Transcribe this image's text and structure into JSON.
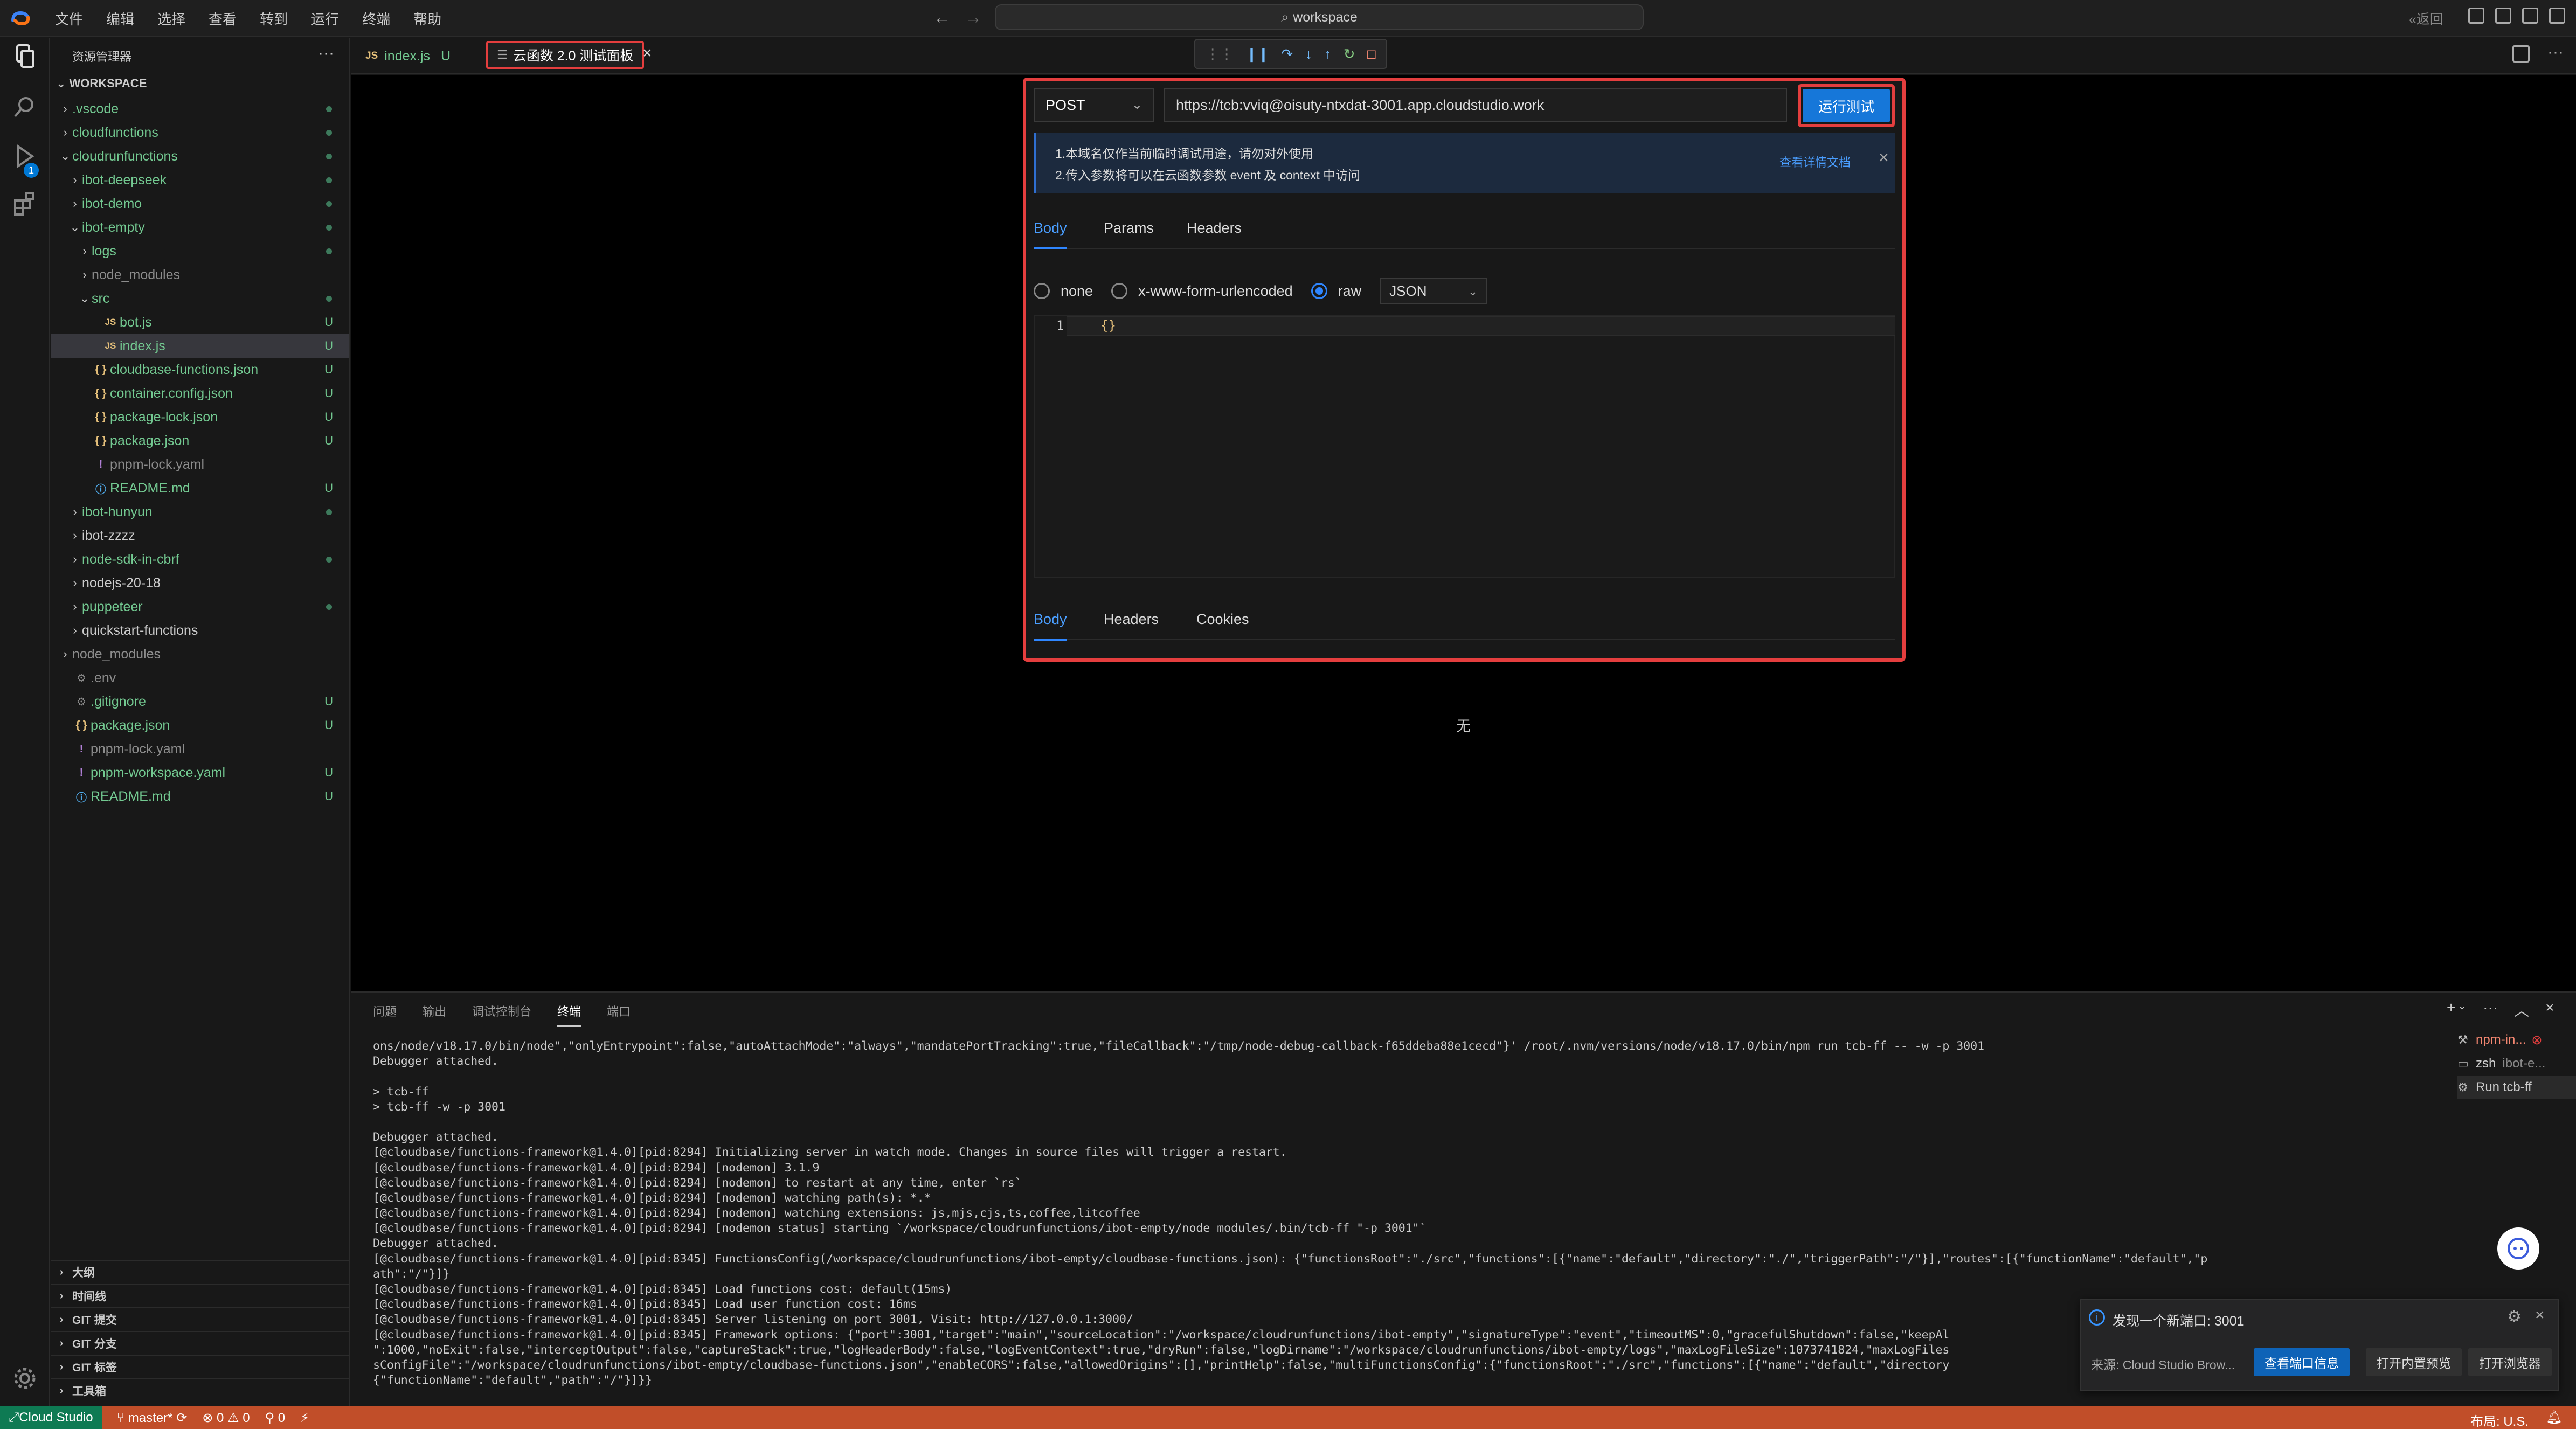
{
  "menus": [
    "文件",
    "编辑",
    "选择",
    "查看",
    "转到",
    "运行",
    "终端",
    "帮助"
  ],
  "command_center": "workspace",
  "return_label": "返回",
  "activity": [
    "files-icon",
    "search-icon",
    "run-debug-icon",
    "extensions-icon",
    "settings-gear-icon"
  ],
  "activity_badge": "1",
  "sidebar": {
    "title": "资源管理器",
    "workspace": "WORKSPACE",
    "items": [
      {
        "label": ".vscode",
        "indent": 1,
        "kind": "folder",
        "open": false,
        "color": "green",
        "status": "dot"
      },
      {
        "label": "cloudfunctions",
        "indent": 1,
        "kind": "folder",
        "open": false,
        "color": "green",
        "status": "dot"
      },
      {
        "label": "cloudrunfunctions",
        "indent": 1,
        "kind": "folder",
        "open": true,
        "color": "green",
        "status": "dot"
      },
      {
        "label": "ibot-deepseek",
        "indent": 2,
        "kind": "folder",
        "open": false,
        "color": "green",
        "status": "dot"
      },
      {
        "label": "ibot-demo",
        "indent": 2,
        "kind": "folder",
        "open": false,
        "color": "green",
        "status": "dot"
      },
      {
        "label": "ibot-empty",
        "indent": 2,
        "kind": "folder",
        "open": true,
        "color": "green",
        "status": "dot"
      },
      {
        "label": "logs",
        "indent": 3,
        "kind": "folder",
        "open": false,
        "color": "green",
        "status": "dot"
      },
      {
        "label": "node_modules",
        "indent": 3,
        "kind": "folder",
        "open": false,
        "color": "gray",
        "status": ""
      },
      {
        "label": "src",
        "indent": 3,
        "kind": "folder",
        "open": true,
        "color": "green",
        "status": "dot"
      },
      {
        "label": "bot.js",
        "indent": 4,
        "kind": "js",
        "color": "green",
        "status": "U"
      },
      {
        "label": "index.js",
        "indent": 4,
        "kind": "js",
        "color": "green",
        "status": "U",
        "selected": true
      },
      {
        "label": "cloudbase-functions.json",
        "indent": 3,
        "kind": "json",
        "color": "green",
        "status": "U"
      },
      {
        "label": "container.config.json",
        "indent": 3,
        "kind": "json",
        "color": "green",
        "status": "U"
      },
      {
        "label": "package-lock.json",
        "indent": 3,
        "kind": "json",
        "color": "green",
        "status": "U"
      },
      {
        "label": "package.json",
        "indent": 3,
        "kind": "json",
        "color": "green",
        "status": "U"
      },
      {
        "label": "pnpm-lock.yaml",
        "indent": 3,
        "kind": "yaml",
        "color": "gray",
        "status": ""
      },
      {
        "label": "README.md",
        "indent": 3,
        "kind": "info",
        "color": "green",
        "status": "U"
      },
      {
        "label": "ibot-hunyun",
        "indent": 2,
        "kind": "folder",
        "open": false,
        "color": "green",
        "status": "dot"
      },
      {
        "label": "ibot-zzzz",
        "indent": 2,
        "kind": "folder",
        "open": false,
        "color": "white",
        "status": ""
      },
      {
        "label": "node-sdk-in-cbrf",
        "indent": 2,
        "kind": "folder",
        "open": false,
        "color": "green",
        "status": "dot"
      },
      {
        "label": "nodejs-20-18",
        "indent": 2,
        "kind": "folder",
        "open": false,
        "color": "white",
        "status": ""
      },
      {
        "label": "puppeteer",
        "indent": 2,
        "kind": "folder",
        "open": false,
        "color": "green",
        "status": "dot"
      },
      {
        "label": "quickstart-functions",
        "indent": 2,
        "kind": "folder",
        "open": false,
        "color": "white",
        "status": ""
      },
      {
        "label": "node_modules",
        "indent": 1,
        "kind": "folder",
        "open": false,
        "color": "gray",
        "status": ""
      },
      {
        "label": ".env",
        "indent": 1,
        "kind": "gear",
        "color": "gray",
        "status": ""
      },
      {
        "label": ".gitignore",
        "indent": 1,
        "kind": "gear",
        "color": "green",
        "status": "U"
      },
      {
        "label": "package.json",
        "indent": 1,
        "kind": "json",
        "color": "green",
        "status": "U"
      },
      {
        "label": "pnpm-lock.yaml",
        "indent": 1,
        "kind": "yaml",
        "color": "gray",
        "status": ""
      },
      {
        "label": "pnpm-workspace.yaml",
        "indent": 1,
        "kind": "yaml",
        "color": "green",
        "status": "U"
      },
      {
        "label": "README.md",
        "indent": 1,
        "kind": "info",
        "color": "green",
        "status": "U"
      }
    ],
    "sections": [
      "大纲",
      "时间线",
      "GIT 提交",
      "GIT 分支",
      "GIT 标签",
      "工具箱"
    ]
  },
  "tabs": {
    "tab1": {
      "icon": "JS",
      "label": "index.js",
      "status": "U"
    },
    "tab2": {
      "label": "云函数 2.0 测试面板"
    }
  },
  "debug_toolbar": [
    "drag-handle-icon",
    "pause-icon",
    "step-over-icon",
    "step-into-icon",
    "step-out-icon",
    "restart-icon",
    "stop-icon"
  ],
  "test_panel": {
    "method": "POST",
    "url": "https://tcb:vviq@oisuty-ntxdat-3001.app.cloudstudio.work",
    "run_button": "运行测试",
    "info_line1": "1.本域名仅作当前临时调试用途，请勿对外使用",
    "info_line2": "2.传入参数将可以在云函数参数 event 及 context 中访问",
    "info_link": "查看详情文档",
    "request_tabs": [
      "Body",
      "Params",
      "Headers"
    ],
    "body_types": [
      "none",
      "x-www-form-urlencoded",
      "raw"
    ],
    "selected_body_type": "raw",
    "format": "JSON",
    "code_line_number": "1",
    "code": "{}",
    "response_tabs": [
      "Body",
      "Headers",
      "Cookies"
    ],
    "response_empty": "无"
  },
  "panel": {
    "tabs": [
      "问题",
      "输出",
      "调试控制台",
      "终端",
      "端口"
    ],
    "active_tab": "终端",
    "terminal_lines": [
      "ons/node/v18.17.0/bin/node\",\"onlyEntrypoint\":false,\"autoAttachMode\":\"always\",\"mandatePortTracking\":true,\"fileCallback\":\"/tmp/node-debug-callback-f65ddeba88e1cecd\"}' /root/.nvm/versions/node/v18.17.0/bin/npm run tcb-ff -- -w -p 3001",
      "Debugger attached.",
      "",
      "> tcb-ff",
      "> tcb-ff -w -p 3001",
      "",
      "Debugger attached.",
      "[@cloudbase/functions-framework@1.4.0][pid:8294] Initializing server in watch mode. Changes in source files will trigger a restart.",
      "[@cloudbase/functions-framework@1.4.0][pid:8294] [nodemon] 3.1.9",
      "[@cloudbase/functions-framework@1.4.0][pid:8294] [nodemon] to restart at any time, enter `rs`",
      "[@cloudbase/functions-framework@1.4.0][pid:8294] [nodemon] watching path(s): *.*",
      "[@cloudbase/functions-framework@1.4.0][pid:8294] [nodemon] watching extensions: js,mjs,cjs,ts,coffee,litcoffee",
      "[@cloudbase/functions-framework@1.4.0][pid:8294] [nodemon status] starting `/workspace/cloudrunfunctions/ibot-empty/node_modules/.bin/tcb-ff \"-p 3001\"`",
      "Debugger attached.",
      "[@cloudbase/functions-framework@1.4.0][pid:8345] FunctionsConfig(/workspace/cloudrunfunctions/ibot-empty/cloudbase-functions.json): {\"functionsRoot\":\"./src\",\"functions\":[{\"name\":\"default\",\"directory\":\"./\",\"triggerPath\":\"/\"}],\"routes\":[{\"functionName\":\"default\",\"p",
      "ath\":\"/\"}]}",
      "[@cloudbase/functions-framework@1.4.0][pid:8345] Load functions cost: default(15ms)",
      "[@cloudbase/functions-framework@1.4.0][pid:8345] Load user function cost: 16ms",
      "[@cloudbase/functions-framework@1.4.0][pid:8345] Server listening on port 3001, Visit: http://127.0.0.1:3000/",
      "[@cloudbase/functions-framework@1.4.0][pid:8345] Framework options: {\"port\":3001,\"target\":\"main\",\"sourceLocation\":\"/workspace/cloudrunfunctions/ibot-empty\",\"signatureType\":\"event\",\"timeoutMS\":0,\"gracefulShutdown\":false,\"keepAl",
      "\":1000,\"noExit\":false,\"interceptOutput\":false,\"captureStack\":true,\"logHeaderBody\":false,\"logEventContext\":true,\"dryRun\":false,\"logDirname\":\"/workspace/cloudrunfunctions/ibot-empty/logs\",\"maxLogFileSize\":1073741824,\"maxLogFiles",
      "sConfigFile\":\"/workspace/cloudrunfunctions/ibot-empty/cloudbase-functions.json\",\"enableCORS\":false,\"allowedOrigins\":[],\"printHelp\":false,\"multiFunctionsConfig\":{\"functionsRoot\":\"./src\",\"functions\":[{\"name\":\"default\",\"directory",
      "{\"functionName\":\"default\",\"path\":\"/\"}]}}"
    ],
    "terminals": [
      {
        "icon": "tools-icon",
        "label": "npm-in...",
        "error": true
      },
      {
        "icon": "terminal-icon",
        "label": "zsh",
        "sub": "ibot-e..."
      },
      {
        "icon": "gear-icon",
        "label": "Run tcb-ff"
      }
    ]
  },
  "notification": {
    "message": "发现一个新端口: 3001",
    "source": "来源: Cloud Studio Brow...",
    "buttons": [
      "查看端口信息",
      "打开内置预览",
      "打开浏览器"
    ]
  },
  "status": {
    "remote": "Cloud Studio",
    "branch": "master*",
    "problems": "0",
    "warnings": "0",
    "ports": "0",
    "layout": "布局: U.S."
  }
}
